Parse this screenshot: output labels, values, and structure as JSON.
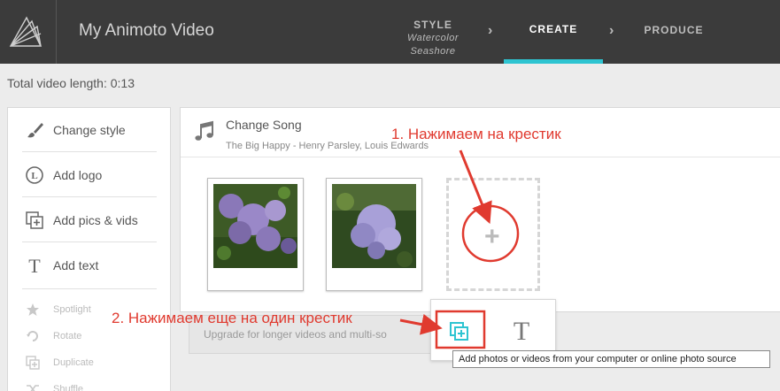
{
  "app": {
    "title": "My Animoto Video"
  },
  "steps": {
    "style_label": "STYLE",
    "style_value_1": "Watercolor",
    "style_value_2": "Seashore",
    "create_label": "CREATE",
    "produce_label": "PRODUCE"
  },
  "total_length": "Total video length: 0:13",
  "sidebar": {
    "main_items": [
      {
        "label": "Change style",
        "icon": "brush-icon"
      },
      {
        "label": "Add logo",
        "icon": "logo-icon"
      },
      {
        "label": "Add pics & vids",
        "icon": "add-media-icon"
      },
      {
        "label": "Add text",
        "icon": "text-icon"
      }
    ],
    "sub_items": [
      {
        "label": "Spotlight",
        "icon": "star-icon"
      },
      {
        "label": "Rotate",
        "icon": "rotate-icon"
      },
      {
        "label": "Duplicate",
        "icon": "duplicate-icon"
      },
      {
        "label": "Shuffle",
        "icon": "shuffle-icon"
      }
    ]
  },
  "song": {
    "title": "Change Song",
    "name": "The Big Happy - Henry Parsley, Louis Edwards"
  },
  "upgrade": "Upgrade for longer videos and multi-so",
  "popup": {
    "text_button": "T"
  },
  "tooltip": "Add photos or videos from your computer or online photo source",
  "annotations": {
    "step1": "1. Нажимаем на крестик",
    "step2": "2. Нажимаем еще на один крестик"
  },
  "colors": {
    "accent": "#2ec4d1",
    "annotation": "#e03a2f",
    "topbar": "#3b3b3b"
  }
}
